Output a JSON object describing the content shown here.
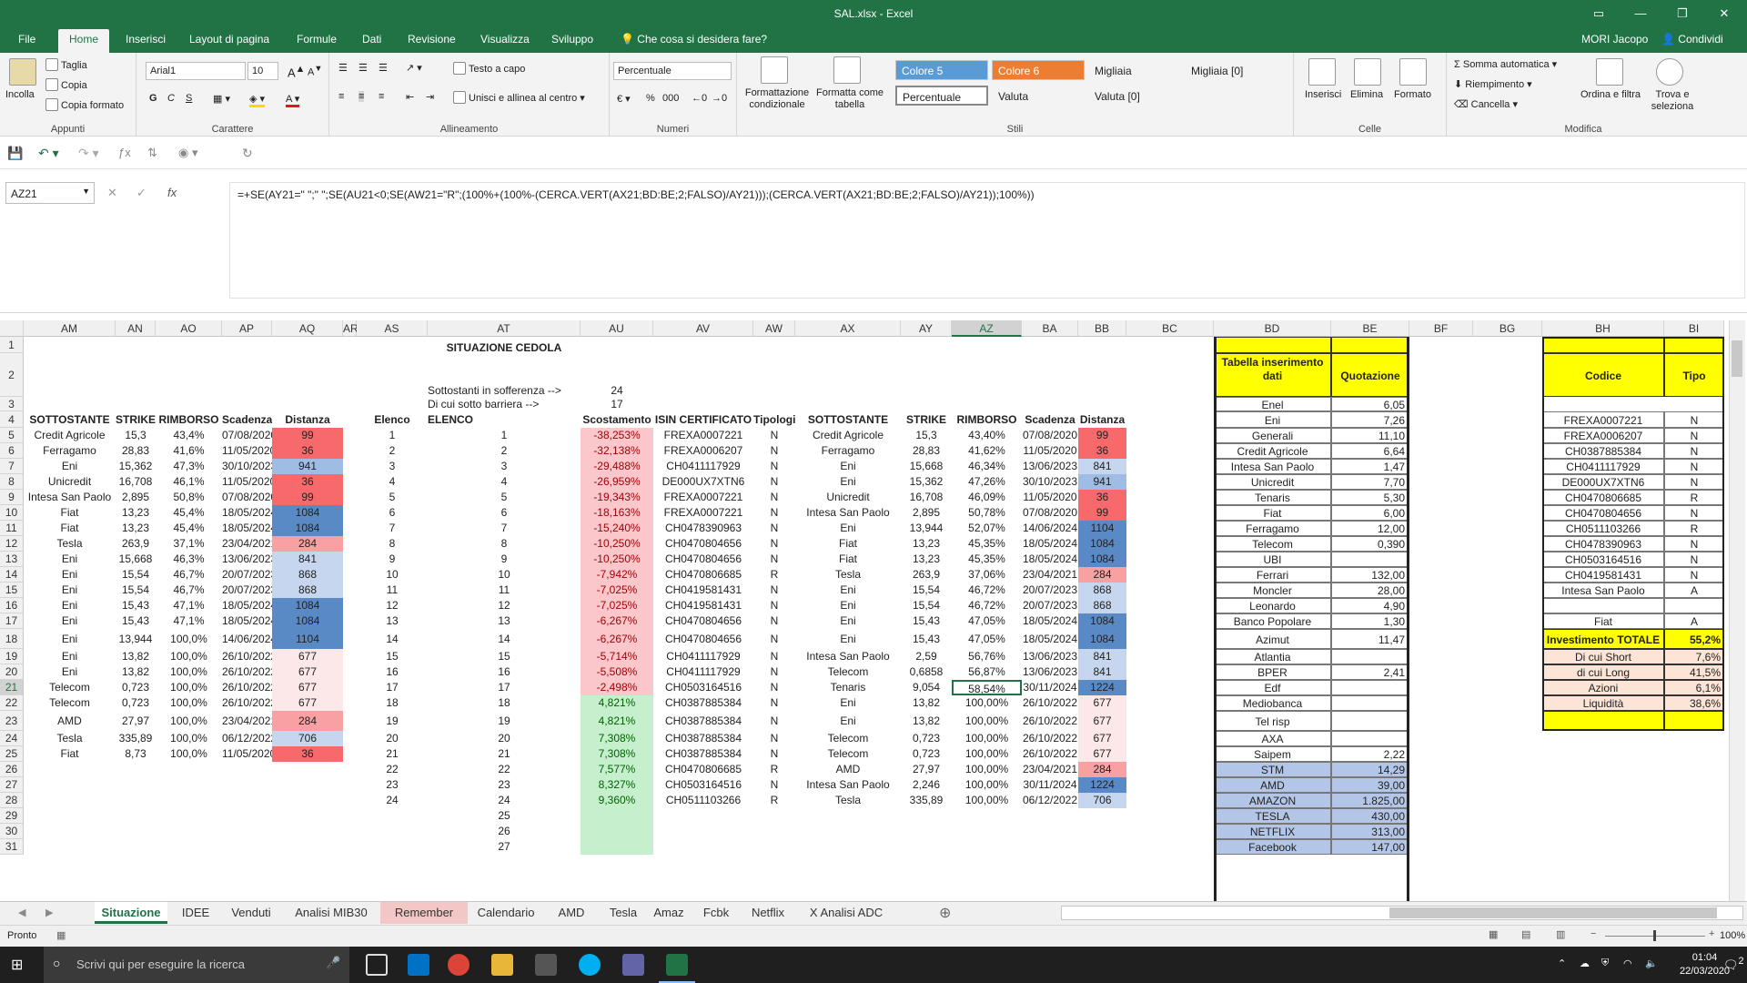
{
  "window": {
    "title": "SAL.xlsx - Excel",
    "user": "MORI Jacopo",
    "share": "Condividi"
  },
  "ribbon_tabs": [
    "File",
    "Home",
    "Inserisci",
    "Layout di pagina",
    "Formule",
    "Dati",
    "Revisione",
    "Visualizza",
    "Sviluppo",
    "Che cosa si desidera fare?"
  ],
  "ribbon": {
    "clipboard": {
      "paste": "Incolla",
      "cut": "Taglia",
      "copy": "Copia",
      "format_painter": "Copia formato",
      "label": "Appunti"
    },
    "font": {
      "name": "Arial1",
      "size": "10",
      "bold": "G",
      "italic": "C",
      "underline": "S",
      "label": "Carattere"
    },
    "alignment": {
      "wrap": "Testo a capo",
      "merge": "Unisci e allinea al centro",
      "label": "Allineamento"
    },
    "number": {
      "format": "Percentuale",
      "label": "Numeri"
    },
    "styles": {
      "cond": "Formattazione condizionale",
      "table": "Formatta come tabella",
      "label": "Stili",
      "cells": [
        "Colore 5",
        "Colore 6",
        "Migliaia",
        "Migliaia [0]",
        "Percentuale",
        "Valuta",
        "Valuta [0]"
      ]
    },
    "cells_group": {
      "insert": "Inserisci",
      "delete": "Elimina",
      "format": "Formato",
      "label": "Celle"
    },
    "editing": {
      "autosum": "Somma automatica",
      "fill": "Riempimento",
      "clear": "Cancella",
      "sort": "Ordina e filtra",
      "find": "Trova e seleziona",
      "label": "Modifica"
    }
  },
  "formula_bar": {
    "name_box": "AZ21",
    "fx": "fx",
    "formula": "=+SE(AY21=\" \";\" \";SE(AU21<0;SE(AW21=\"R\";(100%+(100%-(CERCA.VERT(AX21;BD:BE;2;FALSO)/AY21)));(CERCA.VERT(AX21;BD:BE;2;FALSO)/AY21));100%))"
  },
  "columns": [
    "AM",
    "AN",
    "AO",
    "AP",
    "AQ",
    "AR",
    "AS",
    "AT",
    "AU",
    "AV",
    "AW",
    "AX",
    "AY",
    "AZ",
    "BA",
    "BB",
    "BC",
    "BD",
    "BE",
    "BF",
    "BG",
    "BH",
    "BI"
  ],
  "rows": [
    "1",
    "2",
    "3",
    "4",
    "5",
    "6",
    "7",
    "8",
    "9",
    "10",
    "11",
    "12",
    "13",
    "14",
    "15",
    "16",
    "17",
    "18",
    "19",
    "20",
    "21",
    "22",
    "23",
    "24",
    "25",
    "26",
    "27",
    "28",
    "29",
    "30",
    "31"
  ],
  "sheet": {
    "title": "SITUAZIONE CEDOLA",
    "sofferenza_label": "Sottostanti in sofferenza -->",
    "sofferenza_value": "24",
    "barriera_label": "Di cui sotto barriera -->",
    "barriera_value": "17",
    "left_headers": [
      "SOTTOSTANTE",
      "STRIKE",
      "RIMBORSO",
      "Scadenza",
      "Distanza"
    ],
    "left_rows": [
      [
        "Credit Agricole",
        "15,3",
        "43,4%",
        "07/08/2020",
        "99"
      ],
      [
        "Ferragamo",
        "28,83",
        "41,6%",
        "11/05/2020",
        "36"
      ],
      [
        "Eni",
        "15,362",
        "47,3%",
        "30/10/2023",
        "941"
      ],
      [
        "Unicredit",
        "16,708",
        "46,1%",
        "11/05/2020",
        "36"
      ],
      [
        "Intesa San Paolo",
        "2,895",
        "50,8%",
        "07/08/2020",
        "99"
      ],
      [
        "Fiat",
        "13,23",
        "45,4%",
        "18/05/2024",
        "1084"
      ],
      [
        "Fiat",
        "13,23",
        "45,4%",
        "18/05/2024",
        "1084"
      ],
      [
        "Tesla",
        "263,9",
        "37,1%",
        "23/04/2021",
        "284"
      ],
      [
        "Eni",
        "15,668",
        "46,3%",
        "13/06/2023",
        "841"
      ],
      [
        "Eni",
        "15,54",
        "46,7%",
        "20/07/2023",
        "868"
      ],
      [
        "Eni",
        "15,54",
        "46,7%",
        "20/07/2023",
        "868"
      ],
      [
        "Eni",
        "15,43",
        "47,1%",
        "18/05/2024",
        "1084"
      ],
      [
        "Eni",
        "15,43",
        "47,1%",
        "18/05/2024",
        "1084"
      ],
      [
        "Eni",
        "13,944",
        "100,0%",
        "14/06/2024",
        "1104"
      ],
      [
        "Eni",
        "13,82",
        "100,0%",
        "26/10/2022",
        "677"
      ],
      [
        "Eni",
        "13,82",
        "100,0%",
        "26/10/2022",
        "677"
      ],
      [
        "Telecom",
        "0,723",
        "100,0%",
        "26/10/2022",
        "677"
      ],
      [
        "Telecom",
        "0,723",
        "100,0%",
        "26/10/2022",
        "677"
      ],
      [
        "AMD",
        "27,97",
        "100,0%",
        "23/04/2021",
        "284"
      ],
      [
        "Tesla",
        "335,89",
        "100,0%",
        "06/12/2022",
        "706"
      ],
      [
        "Fiat",
        "8,73",
        "100,0%",
        "11/05/2020",
        "36"
      ]
    ],
    "mid_headers": [
      "Elenco",
      "ELENCO",
      "Scostamento",
      "ISIN CERTIFICATO",
      "Tipologia",
      "SOTTOSTANTE",
      "STRIKE",
      "RIMBORSO",
      "Scadenza",
      "Distanza"
    ],
    "elenco_as": [
      "1",
      "2",
      "3",
      "4",
      "5",
      "6",
      "7",
      "8",
      "9",
      "10",
      "11",
      "12",
      "13",
      "14",
      "15",
      "16",
      "17",
      "18",
      "19",
      "20",
      "21",
      "22",
      "23",
      "24"
    ],
    "elenco_at": [
      "1",
      "2",
      "3",
      "4",
      "5",
      "6",
      "7",
      "8",
      "9",
      "10",
      "11",
      "12",
      "13",
      "14",
      "15",
      "16",
      "17",
      "18",
      "19",
      "20",
      "21",
      "22",
      "23",
      "24",
      "25",
      "26",
      "27"
    ],
    "mid_rows": [
      [
        "-38,253%",
        "FREXA0007221",
        "N",
        "Credit Agricole",
        "15,3",
        "43,40%",
        "07/08/2020",
        "99"
      ],
      [
        "-32,138%",
        "FREXA0006207",
        "N",
        "Ferragamo",
        "28,83",
        "41,62%",
        "11/05/2020",
        "36"
      ],
      [
        "-29,488%",
        "CH0411117929",
        "N",
        "Eni",
        "15,668",
        "46,34%",
        "13/06/2023",
        "841"
      ],
      [
        "-26,959%",
        "DE000UX7XTN6",
        "N",
        "Eni",
        "15,362",
        "47,26%",
        "30/10/2023",
        "941"
      ],
      [
        "-19,343%",
        "FREXA0007221",
        "N",
        "Unicredit",
        "16,708",
        "46,09%",
        "11/05/2020",
        "36"
      ],
      [
        "-18,163%",
        "FREXA0007221",
        "N",
        "Intesa San Paolo",
        "2,895",
        "50,78%",
        "07/08/2020",
        "99"
      ],
      [
        "-15,240%",
        "CH0478390963",
        "N",
        "Eni",
        "13,944",
        "52,07%",
        "14/06/2024",
        "1104"
      ],
      [
        "-10,250%",
        "CH0470804656",
        "N",
        "Fiat",
        "13,23",
        "45,35%",
        "18/05/2024",
        "1084"
      ],
      [
        "-10,250%",
        "CH0470804656",
        "N",
        "Fiat",
        "13,23",
        "45,35%",
        "18/05/2024",
        "1084"
      ],
      [
        "-7,942%",
        "CH0470806685",
        "R",
        "Tesla",
        "263,9",
        "37,06%",
        "23/04/2021",
        "284"
      ],
      [
        "-7,025%",
        "CH0419581431",
        "N",
        "Eni",
        "15,54",
        "46,72%",
        "20/07/2023",
        "868"
      ],
      [
        "-7,025%",
        "CH0419581431",
        "N",
        "Eni",
        "15,54",
        "46,72%",
        "20/07/2023",
        "868"
      ],
      [
        "-6,267%",
        "CH0470804656",
        "N",
        "Eni",
        "15,43",
        "47,05%",
        "18/05/2024",
        "1084"
      ],
      [
        "-6,267%",
        "CH0470804656",
        "N",
        "Eni",
        "15,43",
        "47,05%",
        "18/05/2024",
        "1084"
      ],
      [
        "-5,714%",
        "CH0411117929",
        "N",
        "Intesa San Paolo",
        "2,59",
        "56,76%",
        "13/06/2023",
        "841"
      ],
      [
        "-5,508%",
        "CH0411117929",
        "N",
        "Telecom",
        "0,6858",
        "56,87%",
        "13/06/2023",
        "841"
      ],
      [
        "-2,498%",
        "CH0503164516",
        "N",
        "Tenaris",
        "9,054",
        "58,54%",
        "30/11/2024",
        "1224"
      ],
      [
        "4,821%",
        "CH0387885384",
        "N",
        "Eni",
        "13,82",
        "100,00%",
        "26/10/2022",
        "677"
      ],
      [
        "4,821%",
        "CH0387885384",
        "N",
        "Eni",
        "13,82",
        "100,00%",
        "26/10/2022",
        "677"
      ],
      [
        "7,308%",
        "CH0387885384",
        "N",
        "Telecom",
        "0,723",
        "100,00%",
        "26/10/2022",
        "677"
      ],
      [
        "7,308%",
        "CH0387885384",
        "N",
        "Telecom",
        "0,723",
        "100,00%",
        "26/10/2022",
        "677"
      ],
      [
        "7,577%",
        "CH0470806685",
        "R",
        "AMD",
        "27,97",
        "100,00%",
        "23/04/2021",
        "284"
      ],
      [
        "8,327%",
        "CH0503164516",
        "N",
        "Intesa San Paolo",
        "2,246",
        "100,00%",
        "30/11/2024",
        "1224"
      ],
      [
        "9,360%",
        "CH0511103266",
        "R",
        "Tesla",
        "335,89",
        "100,00%",
        "06/12/2022",
        "706"
      ]
    ],
    "bd_header": "Tabella inserimento dati",
    "be_header": "Quotazione",
    "bd_rows": [
      [
        "Enel",
        "6,05"
      ],
      [
        "Eni",
        "7,26"
      ],
      [
        "Generali",
        "11,10"
      ],
      [
        "Credit Agricole",
        "6,64"
      ],
      [
        "Intesa San Paolo",
        "1,47"
      ],
      [
        "Unicredit",
        "7,70"
      ],
      [
        "Tenaris",
        "5,30"
      ],
      [
        "Fiat",
        "6,00"
      ],
      [
        "Ferragamo",
        "12,00"
      ],
      [
        "Telecom",
        "0,390"
      ],
      [
        "UBI",
        ""
      ],
      [
        "Ferrari",
        "132,00"
      ],
      [
        "Moncler",
        "28,00"
      ],
      [
        "Leonardo",
        "4,90"
      ],
      [
        "Banco Popolare",
        "1,30"
      ],
      [
        "Azimut",
        "11,47"
      ],
      [
        "Atlantia",
        ""
      ],
      [
        "BPER",
        "2,41"
      ],
      [
        "Edf",
        ""
      ],
      [
        "Mediobanca",
        ""
      ],
      [
        "Tel risp",
        ""
      ],
      [
        "AXA",
        ""
      ],
      [
        "Saipem",
        "2,22"
      ],
      [
        "STM",
        "14,29"
      ],
      [
        "AMD",
        "39,00"
      ],
      [
        "AMAZON",
        "1.825,00"
      ],
      [
        "TESLA",
        "430,00"
      ],
      [
        "NETFLIX",
        "313,00"
      ],
      [
        "Facebook",
        "147,00"
      ]
    ],
    "bh_header": "Codice",
    "bi_header": "Tipo",
    "bh_rows": [
      [
        "FREXA0007221",
        "N"
      ],
      [
        "FREXA0006207",
        "N"
      ],
      [
        "CH0387885384",
        "N"
      ],
      [
        "CH0411117929",
        "N"
      ],
      [
        "DE000UX7XTN6",
        "N"
      ],
      [
        "CH0470806685",
        "R"
      ],
      [
        "CH0470804656",
        "N"
      ],
      [
        "CH0511103266",
        "R"
      ],
      [
        "CH0478390963",
        "N"
      ],
      [
        "CH0503164516",
        "N"
      ],
      [
        "CH0419581431",
        "N"
      ],
      [
        "Intesa San Paolo",
        "A"
      ],
      [
        "",
        ""
      ],
      [
        "Fiat",
        "A"
      ],
      [
        "",
        ""
      ]
    ],
    "summary": [
      [
        "Investimento TOTALE",
        "55,2%"
      ],
      [
        "Di cui Short",
        "7,6%"
      ],
      [
        "di cui Long",
        "41,5%"
      ],
      [
        "Azioni",
        "6,1%"
      ],
      [
        "Liquidità",
        "38,6%"
      ]
    ]
  },
  "sheet_tabs": [
    "Situazione",
    "IDEE",
    "Venduti",
    "Analisi MIB30",
    "Remember",
    "Calendario",
    "AMD",
    "Tesla",
    "Amaz",
    "Fcbk",
    "Netflix",
    "X Analisi ADC"
  ],
  "status": {
    "ready": "Pronto",
    "zoom": "100%"
  },
  "taskbar": {
    "search": "Scrivi qui per eseguire la ricerca",
    "time": "01:04",
    "date": "22/03/2020",
    "notif": "2"
  }
}
